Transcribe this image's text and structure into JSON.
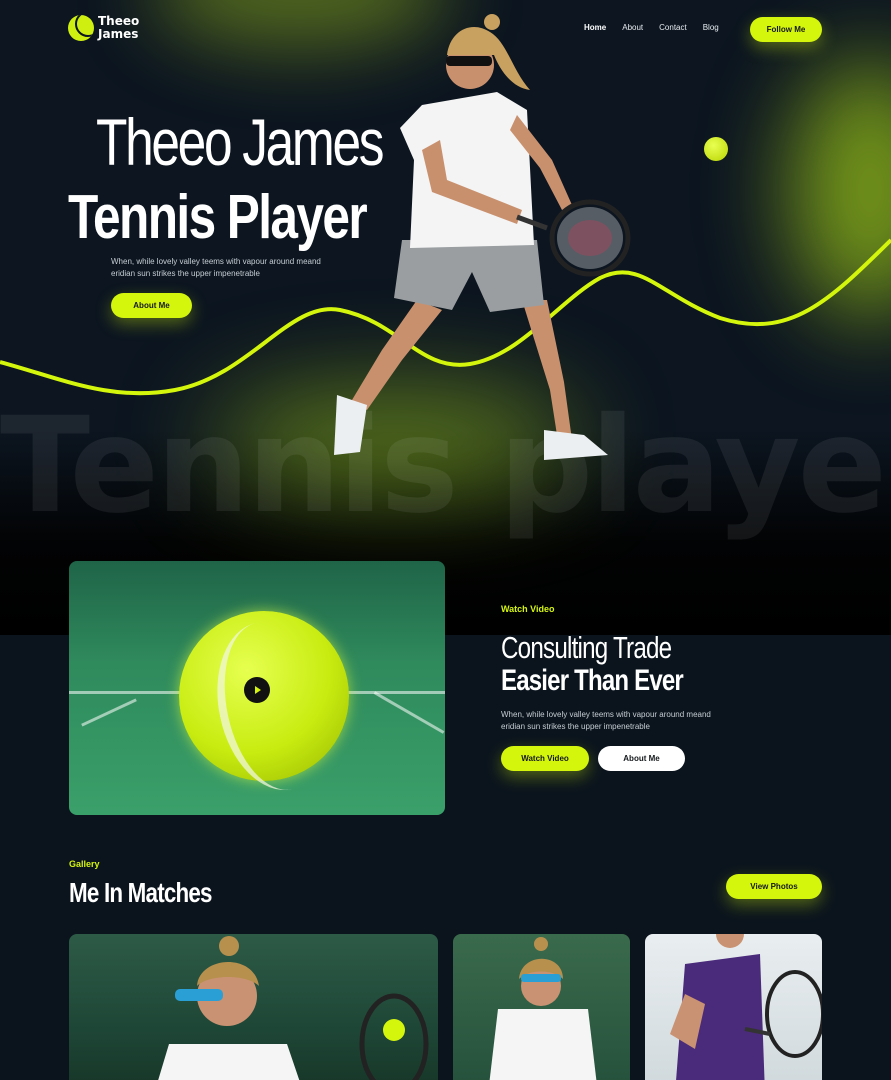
{
  "brand": {
    "line1": "Theeo",
    "line2": "James",
    "accent_color": "#d4f50c",
    "icon": "tennis-ball-icon"
  },
  "nav": {
    "items": [
      {
        "label": "Home",
        "active": true
      },
      {
        "label": "About"
      },
      {
        "label": "Contact"
      },
      {
        "label": "Blog"
      }
    ],
    "follow_label": "Follow Me"
  },
  "hero": {
    "name": "Theeo James",
    "role": "Tennis Player",
    "description": "When, while lovely valley teems with vapour around meand eridian sun strikes the upper impenetrable",
    "cta_label": "About Me",
    "background_word": "Tennis player"
  },
  "video_section": {
    "eyebrow": "Watch Video",
    "title_line1": "Consulting Trade",
    "title_line2": "Easier Than Ever",
    "description": "When, while lovely valley teems with vapour around meand eridian sun strikes the upper impenetrable",
    "primary_label": "Watch Video",
    "secondary_label": "About Me",
    "play_icon": "play-icon"
  },
  "gallery": {
    "eyebrow": "Gallery",
    "title": "Me In Matches",
    "view_label": "View Photos",
    "photos": [
      "match-photo-1",
      "match-photo-2",
      "match-photo-3"
    ]
  }
}
